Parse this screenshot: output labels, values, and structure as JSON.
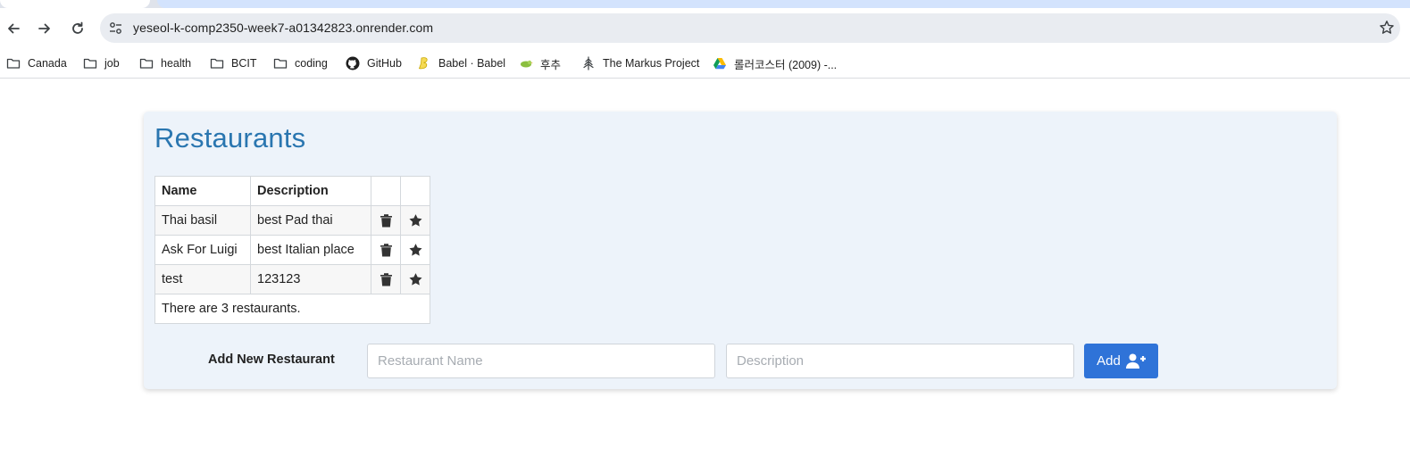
{
  "browser": {
    "url": "yeseol-k-comp2350-week7-a01342823.onrender.com",
    "bookmarks": [
      {
        "label": "Canada",
        "icon": "folder-icon"
      },
      {
        "label": "job",
        "icon": "folder-icon"
      },
      {
        "label": "health",
        "icon": "folder-icon"
      },
      {
        "label": "BCIT",
        "icon": "folder-icon"
      },
      {
        "label": "coding",
        "icon": "folder-icon"
      },
      {
        "label": "GitHub",
        "icon": "github-icon"
      },
      {
        "label": "Babel · Babel",
        "icon": "babel-icon"
      },
      {
        "label": "후추",
        "icon": "bird-icon"
      },
      {
        "label": "The Markus Project",
        "icon": "tree-icon"
      },
      {
        "label": "롤러코스터 (2009) -...",
        "icon": "google-drive-icon"
      }
    ]
  },
  "page": {
    "title": "Restaurants",
    "table": {
      "headers": [
        "Name",
        "Description",
        "",
        ""
      ],
      "rows": [
        {
          "name": "Thai basil",
          "description": "best Pad thai"
        },
        {
          "name": "Ask For Luigi",
          "description": "best Italian place"
        },
        {
          "name": "test",
          "description": "123123"
        }
      ],
      "footer": "There are 3 restaurants."
    },
    "form": {
      "label": "Add New Restaurant",
      "name_placeholder": "Restaurant Name",
      "name_value": "",
      "description_placeholder": "Description",
      "description_value": "",
      "button_label": "Add"
    }
  },
  "colors": {
    "title": "#2a76b0",
    "card_background": "#edf3fa",
    "button": "#2f73d8"
  }
}
